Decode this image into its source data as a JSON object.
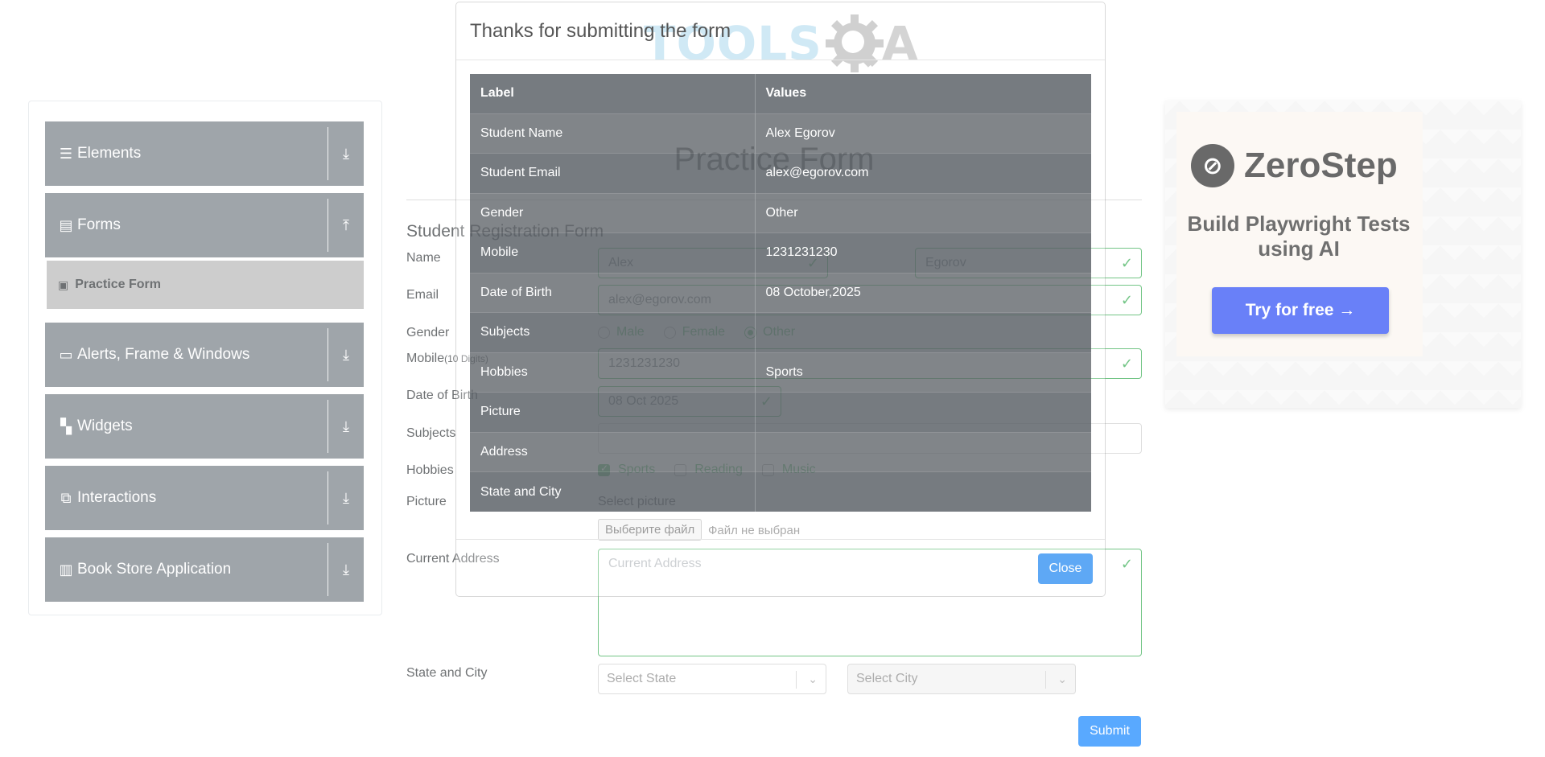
{
  "header": {
    "logo_tools": "TOOLS",
    "logo_a": "A"
  },
  "sidebar": {
    "groups": [
      {
        "label": "Elements",
        "icon": "hamburger-icon",
        "arrow": "download-icon"
      },
      {
        "label": "Forms",
        "icon": "document-icon",
        "arrow": "upload-icon"
      },
      {
        "label": "Alerts, Frame & Windows",
        "icon": "window-icon",
        "arrow": "download-icon"
      },
      {
        "label": "Widgets",
        "icon": "grid-icon",
        "arrow": "download-icon"
      },
      {
        "label": "Interactions",
        "icon": "interaction-icon",
        "arrow": "download-icon"
      },
      {
        "label": "Book Store Application",
        "icon": "books-icon",
        "arrow": "download-icon"
      }
    ],
    "active_item": "Practice Form"
  },
  "form": {
    "page_title": "Practice Form",
    "title": "Student Registration Form",
    "labels": {
      "name": "Name",
      "email": "Email",
      "gender": "Gender",
      "mobile": "Mobile",
      "mobile_hint": "(10 Digits)",
      "dob": "Date of Birth",
      "subjects": "Subjects",
      "hobbies": "Hobbies",
      "picture": "Picture",
      "address": "Current Address",
      "state_city": "State and City"
    },
    "first_name": "Alex",
    "last_name": "Egorov",
    "email": "alex@egorov.com",
    "gender_options": [
      "Male",
      "Female",
      "Other"
    ],
    "gender_selected": "Other",
    "mobile": "1231231230",
    "dob": "08 Oct 2025",
    "hobby_options": [
      "Sports",
      "Reading",
      "Music"
    ],
    "hobbies_checked": [
      "Sports"
    ],
    "picture_label": "Select picture",
    "file_button": "Выберите файл",
    "file_status": "Файл не выбран",
    "address_placeholder": "Current Address",
    "state_placeholder": "Select State",
    "city_placeholder": "Select City",
    "submit": "Submit"
  },
  "ad": {
    "brand": "ZeroStep",
    "tagline": "Build Playwright Tests using AI",
    "cta": "Try for free →"
  },
  "modal": {
    "title": "Thanks for submitting the form",
    "headers": [
      "Label",
      "Values"
    ],
    "rows": [
      {
        "label": "Student Name",
        "value": "Alex Egorov"
      },
      {
        "label": "Student Email",
        "value": "alex@egorov.com"
      },
      {
        "label": "Gender",
        "value": "Other"
      },
      {
        "label": "Mobile",
        "value": "1231231230"
      },
      {
        "label": "Date of Birth",
        "value": "08 October,2025"
      },
      {
        "label": "Subjects",
        "value": ""
      },
      {
        "label": "Hobbies",
        "value": "Sports"
      },
      {
        "label": "Picture",
        "value": ""
      },
      {
        "label": "Address",
        "value": ""
      },
      {
        "label": "State and City",
        "value": ""
      }
    ],
    "close": "Close"
  },
  "colors": {
    "accent": "#007bff",
    "valid": "#28a745",
    "sidebar": "#6c757d"
  }
}
